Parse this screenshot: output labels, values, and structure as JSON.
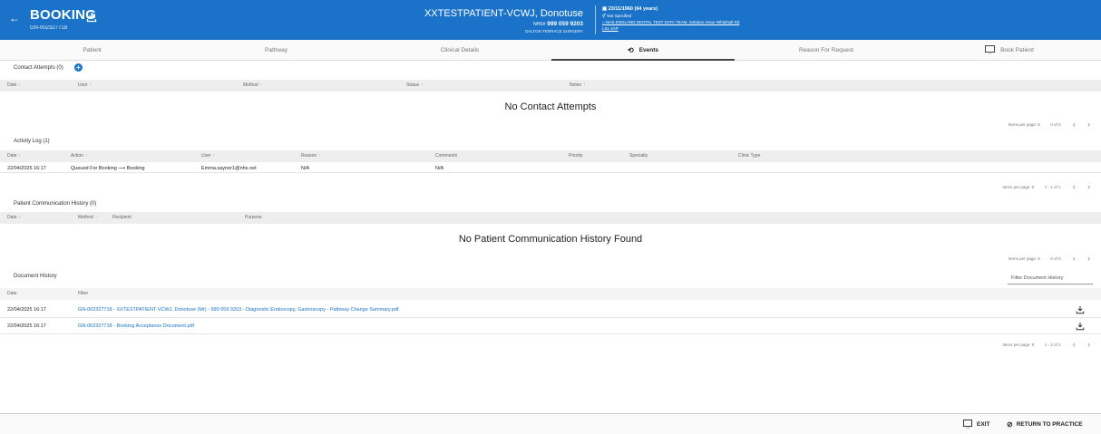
{
  "header": {
    "title": "BOOKING",
    "booking_id": "GN-002327718",
    "patient_name": "XXTESTPATIENT-VCWJ, Donotuse",
    "nhs_label": "NHS#",
    "nhs_number": "999 059 9203",
    "surgery": "DALTON TERRACE SURGERY",
    "dob": "23/11/1960 (64 years)",
    "gender": "Not Specified",
    "practice": "NHS ENGLAND DIGITAL TEST DATA TEAM, Solution Assur Whitehall Rd",
    "postcode": "LS1 4AP",
    "accent_color": "#1a73c8"
  },
  "tabs": [
    {
      "label": "Patient"
    },
    {
      "label": "Pathway"
    },
    {
      "label": "Clinical Details"
    },
    {
      "label": "Events",
      "active": true
    },
    {
      "label": "Reason For Request"
    },
    {
      "label": "Book Patient"
    }
  ],
  "contact_attempts": {
    "title": "Contact Attempts (0)",
    "columns": [
      "Date",
      "User",
      "Method",
      "Status",
      "Notes"
    ],
    "empty_message": "No Contact Attempts",
    "pager": {
      "items_per_page": "Items per page: 5",
      "range": "0 of 0"
    }
  },
  "activity_log": {
    "title": "Activity Log (1)",
    "columns": [
      "Date",
      "Action",
      "User",
      "Reason",
      "Comments",
      "Priority",
      "Specialty",
      "Clinic Type"
    ],
    "rows": [
      {
        "date": "22/04/2025 16:17",
        "action_from": "Queued For Booking",
        "action_to": "Booking",
        "user": "Emma.saynor1@nhs.net",
        "reason": "N/A",
        "comments": "N/A"
      }
    ],
    "pager": {
      "items_per_page": "Items per page: 5",
      "range": "1 - 1 of 1"
    }
  },
  "communication": {
    "title": "Patient Communication History (0)",
    "columns": [
      "Date",
      "Method",
      "Recipient",
      "Purpose"
    ],
    "empty_message": "No Patient Communication History Found",
    "pager": {
      "items_per_page": "Items per page: 5",
      "range": "0 of 0"
    }
  },
  "documents": {
    "title": "Document History",
    "filter_placeholder": "Filter Document History",
    "columns": [
      "Date",
      "Filter"
    ],
    "rows": [
      {
        "date": "22/04/2025 16:17",
        "name": "GN-002327718 - XXTESTPATIENT-VCWJ, Donotuse (Mr) - 999 059 9203 - Diagnostic Endoscopy, Gastroscopy - Pathway Change Summary.pdf"
      },
      {
        "date": "22/04/2025 16:17",
        "name": "GN-002327718 - Booking Acceptance Document.pdf"
      }
    ],
    "pager": {
      "items_per_page": "Items per page: 5",
      "range": "1 - 2 of 2"
    }
  },
  "footer": {
    "exit_label": "EXIT",
    "return_label": "RETURN TO PRACTICE"
  }
}
